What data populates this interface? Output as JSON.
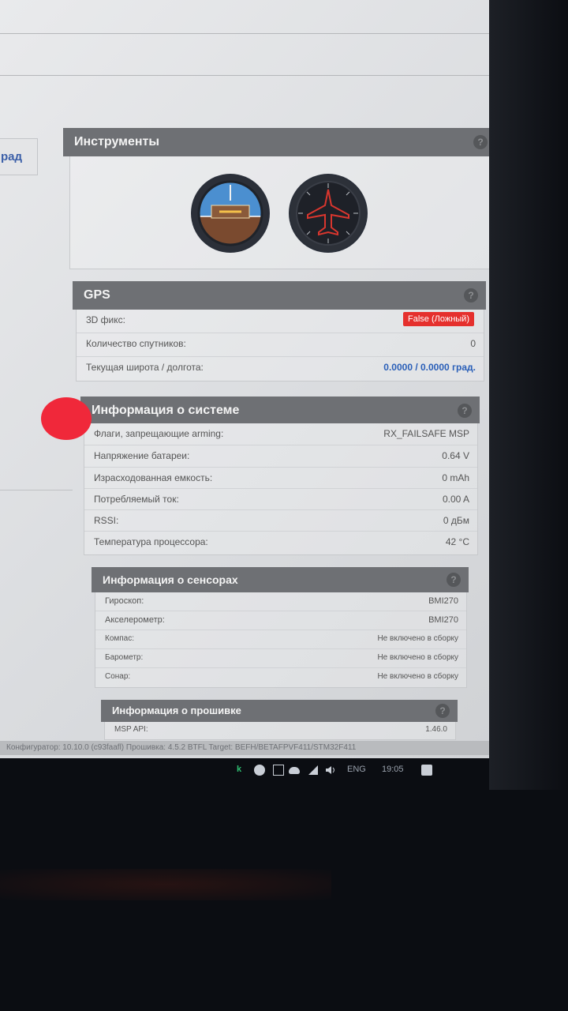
{
  "left_link": "рад",
  "instruments": {
    "title": "Инструменты",
    "help": "?"
  },
  "gps": {
    "title": "GPS",
    "help": "?",
    "rows": [
      {
        "label": "3D фикс:",
        "value": "False (Ложный)"
      },
      {
        "label": "Количество спутников:",
        "value": "0"
      },
      {
        "label": "Текущая широта / долгота:",
        "value": "0.0000 / 0.0000 град."
      }
    ]
  },
  "system": {
    "title": "Информация о системе",
    "help": "?",
    "rows": [
      {
        "label": "Флаги, запрещающие arming:",
        "value": "RX_FAILSAFE  MSP"
      },
      {
        "label": "Напряжение батареи:",
        "value": "0.64 V"
      },
      {
        "label": "Израсходованная емкость:",
        "value": "0 mAh"
      },
      {
        "label": "Потребляемый ток:",
        "value": "0.00 A"
      },
      {
        "label": "RSSI:",
        "value": "0 дБм"
      },
      {
        "label": "Температура процессора:",
        "value": "42 °C"
      }
    ]
  },
  "sensors": {
    "title": "Информация о сенсорах",
    "help": "?",
    "rows": [
      {
        "label": "Гироскоп:",
        "value": "BMI270"
      },
      {
        "label": "Акселерометр:",
        "value": "BMI270"
      },
      {
        "label": "Компас:",
        "value": "Не включено в сборку"
      },
      {
        "label": "Барометр:",
        "value": "Не включено в сборку"
      },
      {
        "label": "Сонар:",
        "value": "Не включено в сборку"
      }
    ]
  },
  "firmware": {
    "title": "Информация о прошивке",
    "help": "?",
    "rows": [
      {
        "label": "MSP API:",
        "value": "1.46.0"
      }
    ]
  },
  "statusbar": "Конфигуратор: 10.10.0 (c93faafl)  Прошивка: 4.5.2 BTFL  Target: BEFH/BETAFPVF411/STM32F411",
  "taskbar": {
    "lang": "ENG",
    "time": "19:05"
  },
  "colors": {
    "header": "#6e7074",
    "error_badge": "#e5302d",
    "link_blue": "#2a5fb8"
  },
  "icons": [
    "kaspersky-icon",
    "app-icon",
    "display-icon",
    "cloud-icon",
    "wifi-icon",
    "volume-icon",
    "notification-icon"
  ]
}
